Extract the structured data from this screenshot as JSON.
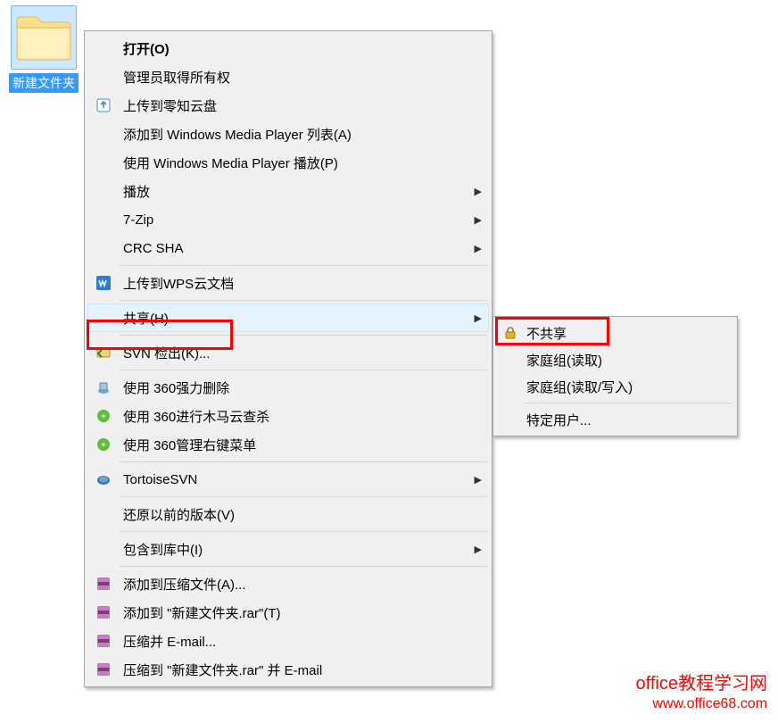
{
  "desktop": {
    "folder_label": "新建文件夹"
  },
  "menu": {
    "open": "打开(O)",
    "admin_own": "管理员取得所有权",
    "upload_lz": "上传到零知云盘",
    "wmp_add": "添加到 Windows Media Player 列表(A)",
    "wmp_play": "使用 Windows Media Player 播放(P)",
    "play": "播放",
    "seven_zip": "7-Zip",
    "crc_sha": "CRC SHA",
    "upload_wps": "上传到WPS云文档",
    "share": "共享(H)",
    "svn_checkout": "SVN 检出(K)...",
    "three60_del": "使用 360强力删除",
    "three60_scan": "使用 360进行木马云查杀",
    "three60_menu": "使用 360管理右键菜单",
    "tortoise": "TortoiseSVN",
    "restore_prev": "还原以前的版本(V)",
    "include_lib": "包含到库中(I)",
    "rar_add": "添加到压缩文件(A)...",
    "rar_add_name": "添加到 \"新建文件夹.rar\"(T)",
    "rar_email": "压缩并 E-mail...",
    "rar_email_name": "压缩到 \"新建文件夹.rar\" 并 E-mail"
  },
  "submenu": {
    "no_share": "不共享",
    "homegroup_read": "家庭组(读取)",
    "homegroup_rw": "家庭组(读取/写入)",
    "specific": "特定用户..."
  },
  "watermark": {
    "line1": "office教程学习网",
    "line2": "www.office68.com"
  }
}
